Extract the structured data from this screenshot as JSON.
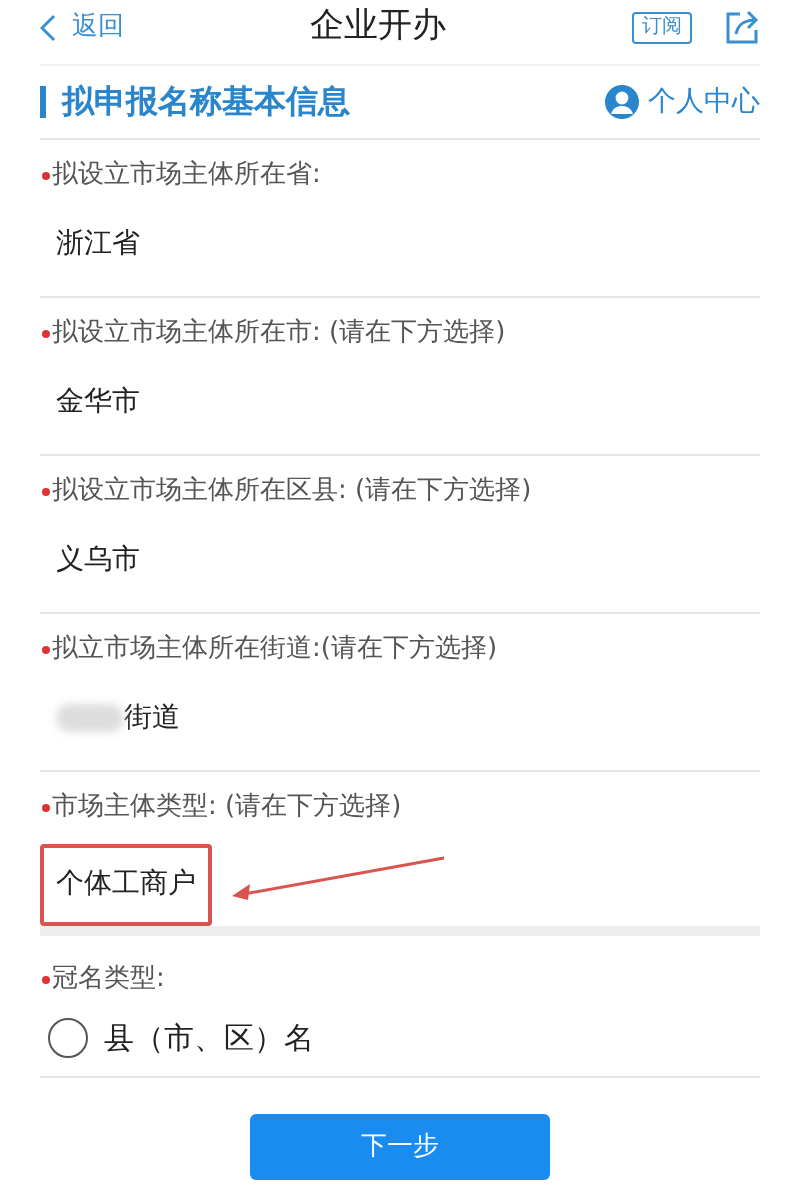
{
  "header": {
    "back": "返回",
    "title": "企业开办",
    "subscribe": "订阅"
  },
  "section": {
    "title": "拟申报名称基本信息",
    "user_link": "个人中心"
  },
  "fields": [
    {
      "label": "拟设立市场主体所在省:",
      "required": true,
      "value": "浙江省",
      "redacted": false,
      "highlighted": false
    },
    {
      "label": "拟设立市场主体所在市: (请在下方选择)",
      "required": true,
      "value": "金华市",
      "redacted": false,
      "highlighted": false
    },
    {
      "label": "拟设立市场主体所在区县: (请在下方选择)",
      "required": true,
      "value": "义乌市",
      "redacted": false,
      "highlighted": false
    },
    {
      "label": "拟立市场主体所在街道:(请在下方选择)",
      "required": true,
      "value": "街道",
      "redacted": true,
      "highlighted": false
    },
    {
      "label": "市场主体类型: (请在下方选择)",
      "required": true,
      "value": "个体工商户",
      "redacted": false,
      "highlighted": true
    }
  ],
  "name_type": {
    "label": "冠名类型:",
    "required": true,
    "options": [
      {
        "label": "县（市、区）名",
        "selected": false
      }
    ]
  },
  "next_button": "下一步"
}
